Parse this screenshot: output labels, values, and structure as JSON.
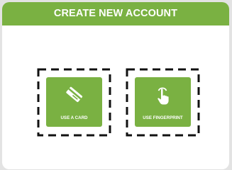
{
  "header": {
    "title": "CREATE NEW ACCOUNT"
  },
  "options": [
    {
      "label": "USE A CARD",
      "icon": "card-icon"
    },
    {
      "label": "USE FINGERPRINT",
      "icon": "fingerprint-touch-icon"
    }
  ],
  "colors": {
    "accent": "#7ab142",
    "panel": "#ffffff",
    "background": "#e3e3e3",
    "dash": "#111111"
  }
}
